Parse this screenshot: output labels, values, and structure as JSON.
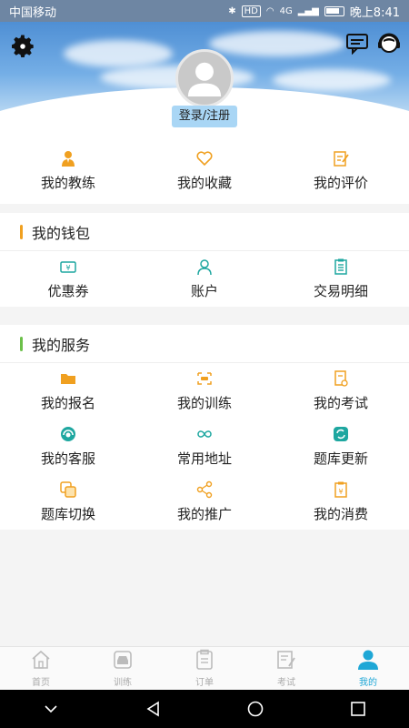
{
  "status_bar": {
    "carrier": "中国移动",
    "time": "晚上8:41",
    "net_badge": "HD",
    "signal_text": "4G"
  },
  "header": {
    "login_label": "登录/注册"
  },
  "quick_row": [
    {
      "label": "我的教练",
      "icon": "coach-icon"
    },
    {
      "label": "我的收藏",
      "icon": "heart-icon"
    },
    {
      "label": "我的评价",
      "icon": "edit-icon"
    }
  ],
  "wallet": {
    "title": "我的钱包",
    "accent": "#f0a020",
    "items": [
      {
        "label": "优惠券",
        "icon": "coupon-icon"
      },
      {
        "label": "账户",
        "icon": "user-icon"
      },
      {
        "label": "交易明细",
        "icon": "list-icon"
      }
    ]
  },
  "services": {
    "title": "我的服务",
    "accent": "#6cc04a",
    "items": [
      {
        "label": "我的报名",
        "icon": "folder-icon"
      },
      {
        "label": "我的训练",
        "icon": "car-icon"
      },
      {
        "label": "我的考试",
        "icon": "exam-icon"
      },
      {
        "label": "我的客服",
        "icon": "headset-icon"
      },
      {
        "label": "常用地址",
        "icon": "infinity-icon"
      },
      {
        "label": "题库更新",
        "icon": "refresh-icon"
      },
      {
        "label": "题库切换",
        "icon": "switch-icon"
      },
      {
        "label": "我的推广",
        "icon": "share-icon"
      },
      {
        "label": "我的消费",
        "icon": "receipt-icon"
      }
    ]
  },
  "tabs": [
    {
      "label": "首页",
      "icon": "home-icon",
      "active": false
    },
    {
      "label": "训练",
      "icon": "car-icon",
      "active": false
    },
    {
      "label": "订单",
      "icon": "clipboard-icon",
      "active": false
    },
    {
      "label": "考试",
      "icon": "exam-icon",
      "active": false
    },
    {
      "label": "我的",
      "icon": "profile-icon",
      "active": true
    }
  ],
  "colors": {
    "orange": "#f0a020",
    "teal": "#1ea7a0",
    "active_tab": "#1ea7d6"
  }
}
